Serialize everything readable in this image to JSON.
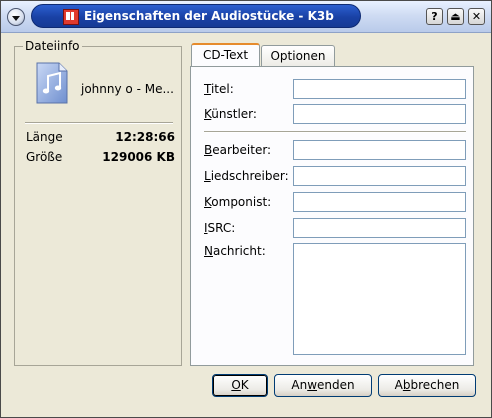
{
  "titlebar": {
    "title": "Eigenschaften der Audiostücke - K3b",
    "help_label": "?",
    "shade_label": "⏏",
    "close_label": "✕"
  },
  "fileinfo": {
    "group_title": "Dateiinfo",
    "file_name": "johnny o - Me...",
    "rows": [
      {
        "label": "Länge",
        "value": "12:28:66"
      },
      {
        "label": "Größe",
        "value": "129006 KB"
      }
    ]
  },
  "tabs": [
    {
      "label": "CD-Text",
      "active": true
    },
    {
      "label": "Optionen",
      "active": false
    }
  ],
  "cdtext": {
    "title": {
      "accel": "T",
      "rest": "itel:",
      "value": ""
    },
    "artist": {
      "accel": "K",
      "rest": "ünstler:",
      "value": ""
    },
    "arranger": {
      "accel": "B",
      "rest": "earbeiter:",
      "value": ""
    },
    "songwriter": {
      "accel": "L",
      "rest": "iedschreiber:",
      "value": ""
    },
    "composer": {
      "accel": "K",
      "rest": "omponist:",
      "value": ""
    },
    "isrc": {
      "accel": "I",
      "rest": "SRC:",
      "value": ""
    },
    "message": {
      "accel": "N",
      "rest": "achricht:",
      "value": ""
    }
  },
  "buttons": {
    "ok": {
      "accel": "O",
      "rest": "K"
    },
    "apply": {
      "pre": "An",
      "accel": "w",
      "rest": "enden"
    },
    "cancel": {
      "pre": "A",
      "accel": "b",
      "rest": "brechen"
    }
  },
  "colors": {
    "titlebar_pill": "#1941a5",
    "active_tab_accent": "#e68b2c",
    "window_bg": "#ece9d8"
  },
  "icons": {
    "window_menu": "chevron-down-icon",
    "app": "k3b-app-icon",
    "file": "audio-file-icon"
  }
}
